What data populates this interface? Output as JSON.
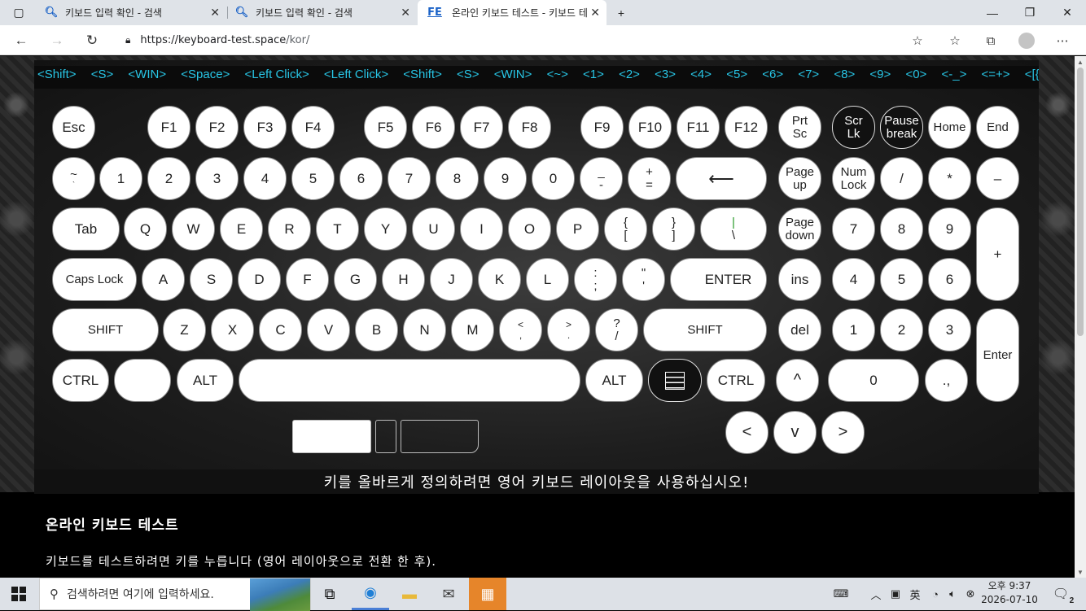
{
  "browser": {
    "tabs": [
      {
        "title": "키보드 입력 확인 - 검색",
        "icon": "search-icon",
        "active": false
      },
      {
        "title": "키보드 입력 확인 - 검색",
        "icon": "search-icon",
        "active": false
      },
      {
        "title": "온라인 키보드 테스트 - 키보드 테",
        "icon": "FE",
        "active": true
      }
    ],
    "new_tab": "+",
    "url": "https://keyboard-test.space/kor/",
    "url_host": "https://keyboard-test.space",
    "url_path": "/kor/"
  },
  "page": {
    "log": [
      "<Shift>",
      "<S>",
      "<WIN>",
      "<Space>",
      "<Left Click>",
      "<Left Click>",
      "<Shift>",
      "<S>",
      "<WIN>",
      "<~>",
      "<1>",
      "<2>",
      "<3>",
      "<4>",
      "<5>",
      "<6>",
      "<7>",
      "<8>",
      "<9>",
      "<0>",
      "<-_>",
      "<=+>",
      "<[{>"
    ],
    "hint": "키를 올바르게 정의하려면 영어 키보드 레이아웃을 사용하십시오!",
    "heading": "온라인 키보드 테스트",
    "description": "키보드를 테스트하려면 키를 누릅니다 (영어 레이아웃으로 전환 한 후).",
    "keys": {
      "esc": "Esc",
      "f1": "F1",
      "f2": "F2",
      "f3": "F3",
      "f4": "F4",
      "f5": "F5",
      "f6": "F6",
      "f7": "F7",
      "f8": "F8",
      "f9": "F9",
      "f10": "F10",
      "f11": "F11",
      "f12": "F12",
      "prtsc_1": "Prt",
      "prtsc_2": "Sc",
      "scrlk_1": "Scr",
      "scrlk_2": "Lk",
      "pause_1": "Pause",
      "pause_2": "break",
      "home": "Home",
      "end": "End",
      "tilde_1": "~",
      "tilde_2": "`",
      "n1": "1",
      "n2": "2",
      "n3": "3",
      "n4": "4",
      "n5": "5",
      "n6": "6",
      "n7": "7",
      "n8": "8",
      "n9": "9",
      "n0": "0",
      "minus_1": "_",
      "minus_2": "-",
      "plus_1": "+",
      "plus_2": "=",
      "backspace": "⟵",
      "pageup_1": "Page",
      "pageup_2": "up",
      "numlock_1": "Num",
      "numlock_2": "Lock",
      "np_div": "/",
      "np_mul": "*",
      "np_minus": "–",
      "tab": "Tab",
      "q": "Q",
      "w": "W",
      "e": "E",
      "r": "R",
      "t": "T",
      "y": "Y",
      "u": "U",
      "i": "I",
      "o": "O",
      "p": "P",
      "lbr_1": "{",
      "lbr_2": "[",
      "rbr_1": "}",
      "rbr_2": "]",
      "bsl_1": "|",
      "bsl_2": "\\",
      "pagedown_1": "Page",
      "pagedown_2": "down",
      "np7": "7",
      "np8": "8",
      "np9": "9",
      "np_plus": "+",
      "caps": "Caps Lock",
      "a": "A",
      "s": "S",
      "d": "D",
      "f": "F",
      "g": "G",
      "h": "H",
      "j": "J",
      "k": "K",
      "l": "L",
      "semi_1": ":",
      "semi_2": ";",
      "quote_1": "\"",
      "quote_2": "'",
      "enter": "ENTER",
      "ins": "ins",
      "np4": "4",
      "np5": "5",
      "np6": "6",
      "lshift": "SHIFT",
      "z": "Z",
      "x": "X",
      "c": "C",
      "v": "V",
      "b": "B",
      "n": "N",
      "m": "M",
      "comma_1": "<",
      "comma_2": ",",
      "period_1": ">",
      "period_2": ".",
      "slash_1": "?",
      "slash_2": "/",
      "rshift": "SHIFT",
      "del": "del",
      "np1": "1",
      "np2": "2",
      "np3": "3",
      "np_enter": "Enter",
      "lctrl": "CTRL",
      "lalt": "ALT",
      "ralt": "ALT",
      "rctrl": "CTRL",
      "up": "^",
      "np0": "0",
      "np_dot": ".,",
      "left": "<",
      "down": "v",
      "right": ">"
    }
  },
  "taskbar": {
    "search_placeholder": "검색하려면 여기에 입력하세요.",
    "time": "오후 9:37",
    "date": "2026-07-10",
    "notifications": "2"
  }
}
